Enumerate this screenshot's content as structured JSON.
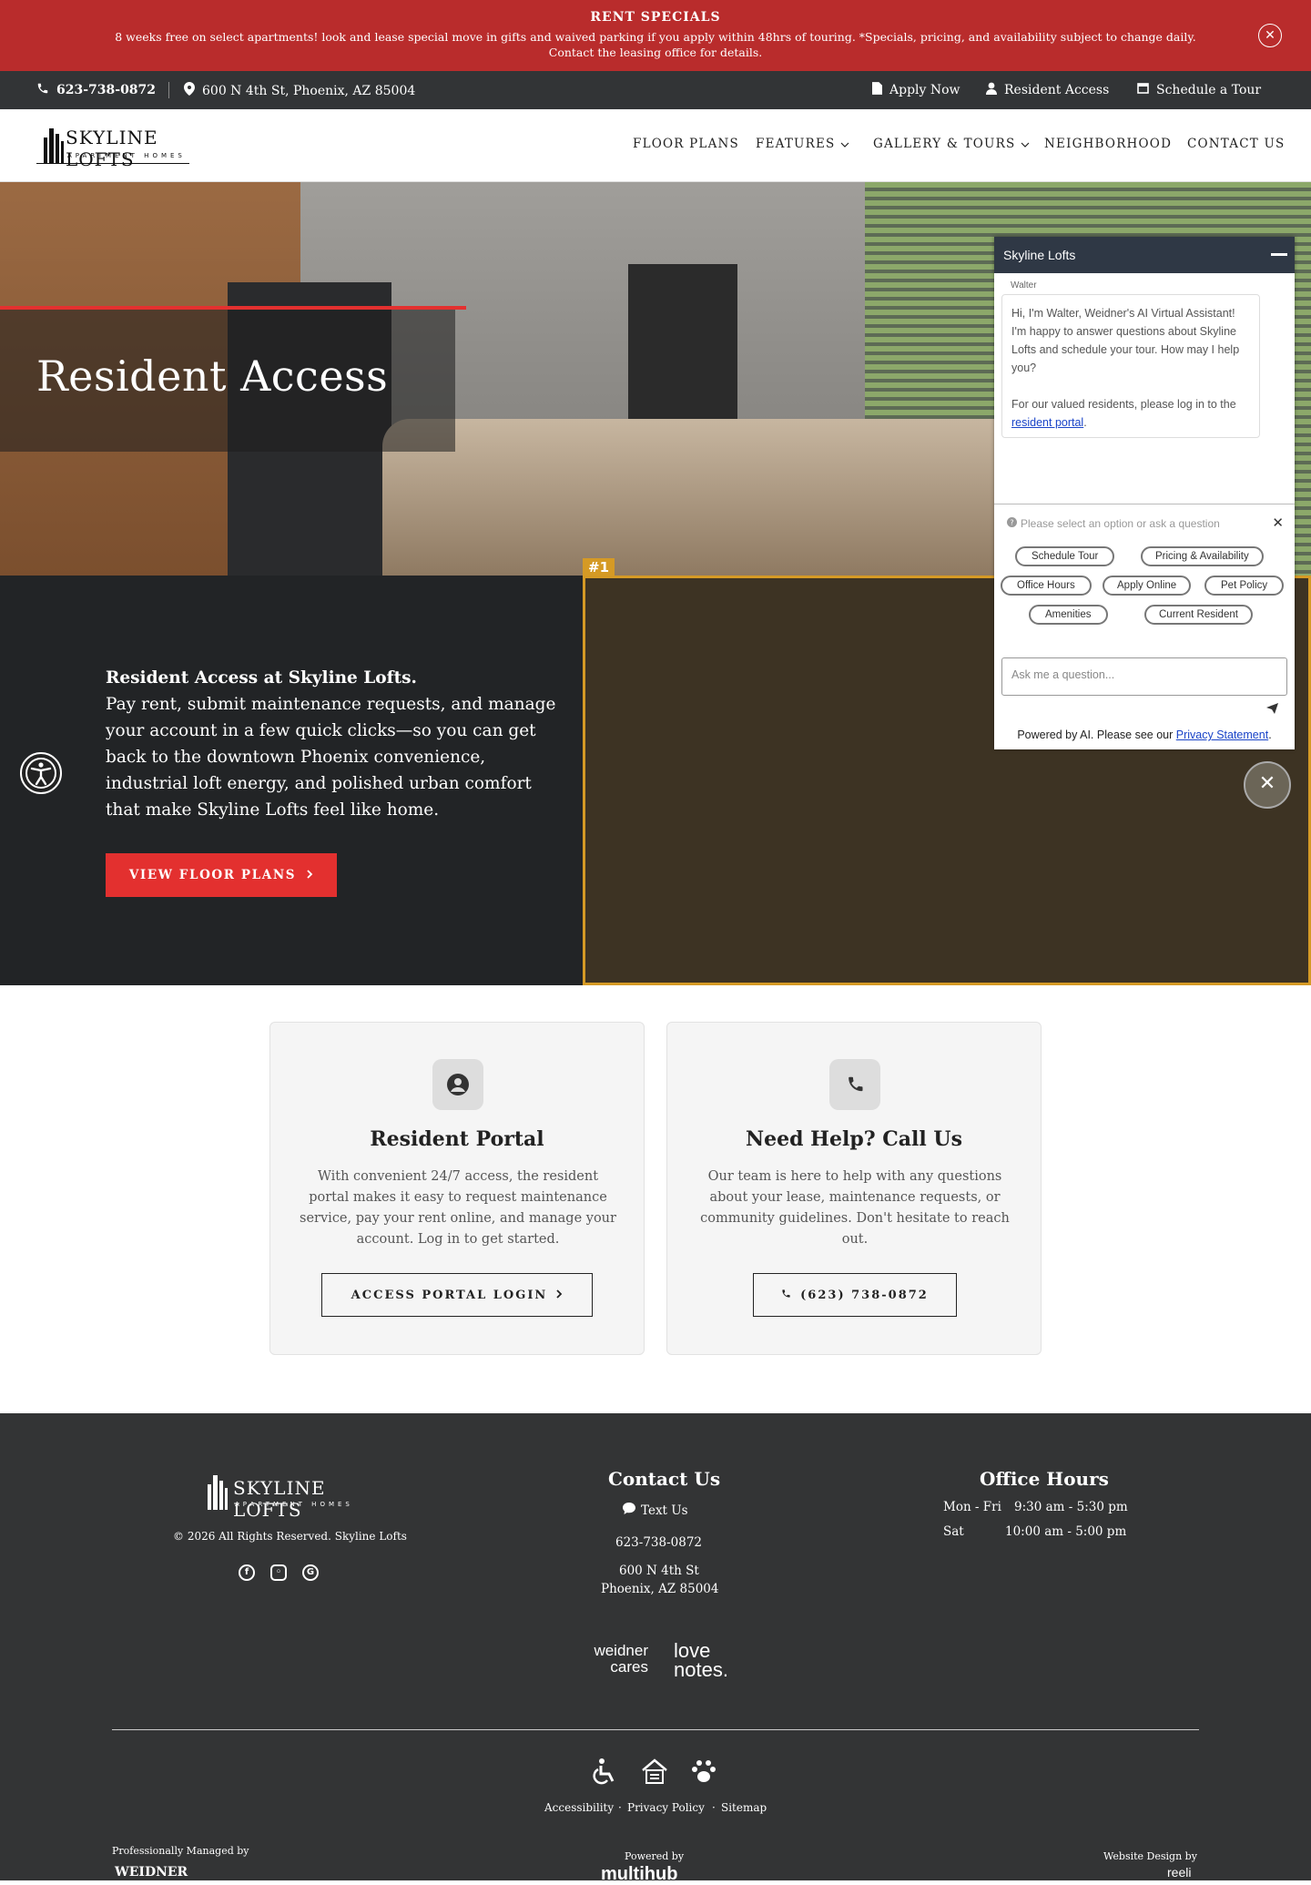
{
  "promo": {
    "title": "RENT SPECIALS",
    "body": "8 weeks free on select apartments! look and lease special move in gifts and waived parking if you apply within 48hrs of touring. *Specials, pricing, and availability subject to change daily. Contact the leasing office for details.",
    "close_icon": "close-icon"
  },
  "topbar": {
    "phone": "623-738-0872",
    "address": "600 N 4th St, Phoenix, AZ 85004",
    "apply": "Apply Now",
    "resident": "Resident Access",
    "tour": "Schedule a Tour"
  },
  "logo": {
    "name": "SKYLINE LOFTS",
    "sub": "APARTMENT HOMES"
  },
  "nav": {
    "items": [
      "FLOOR PLANS",
      "FEATURES",
      "GALLERY & TOURS",
      "NEIGHBORHOOD",
      "CONTACT US"
    ]
  },
  "hero": {
    "title": "Resident Access"
  },
  "intro": {
    "heading": "Resident Access at Skyline Lofts.",
    "body": "Pay rent, submit maintenance requests, and manage your account in a few quick clicks—so you can get back to the downtown Phoenix convenience, industrial loft energy, and polished urban comfort that make Skyline Lofts feel like home.",
    "button": "VIEW FLOOR PLANS",
    "video_tag": "#1"
  },
  "chat": {
    "title": "Skyline Lofts",
    "sender": "Walter",
    "message": "Hi, I'm Walter, Weidner's AI Virtual Assistant! I'm happy to answer questions about Skyline Lofts and schedule your tour. How may I help you?",
    "message2": "For our valued residents, please log in to the",
    "link": "resident portal",
    "prompt": "Please select an option or ask a question",
    "options": [
      "Schedule Tour",
      "Pricing & Availability",
      "Office Hours",
      "Apply Online",
      "Pet Policy",
      "Amenities",
      "Current Resident"
    ],
    "placeholder": "Ask me a question...",
    "powered": "Powered by AI. Please see our",
    "privacy": "Privacy Statement"
  },
  "cards": {
    "portal": {
      "title": "Resident Portal",
      "body": "With convenient 24/7 access, the resident portal makes it easy to request maintenance service, pay your rent online, and manage your account. Log in to get started.",
      "button": "ACCESS PORTAL LOGIN"
    },
    "call": {
      "title": "Need Help? Call Us",
      "body": "Our team is here to help with any questions about your lease, maintenance requests, or community guidelines. Don't hesitate to reach out.",
      "button": "(623) 738-0872"
    }
  },
  "footer": {
    "copyright": "© 2026 All Rights Reserved. Skyline Lofts",
    "contact_title": "Contact Us",
    "text_us": "Text Us",
    "phone": "623-738-0872",
    "address1": "600 N 4th St",
    "address2": "Phoenix, AZ 85004",
    "hours_title": "Office Hours",
    "hours": [
      {
        "day": "Mon - Fri",
        "time": "9:30 am - 5:30 pm"
      },
      {
        "day": "Sat",
        "time": "10:00 am - 5:00 pm"
      }
    ],
    "badge1": "weidner cares",
    "badge2": "love notes.",
    "links": [
      "Accessibility",
      "Privacy Policy",
      "Sitemap"
    ],
    "managed": "Professionally Managed by",
    "managed_logo": "WEIDNER",
    "powered": "Powered by",
    "powered_logo": "multihub",
    "design": "Website Design by",
    "design_logo": "reeli"
  },
  "colors": {
    "brand_red": "#e3302f",
    "dark": "#222426",
    "footer": "#333435"
  }
}
